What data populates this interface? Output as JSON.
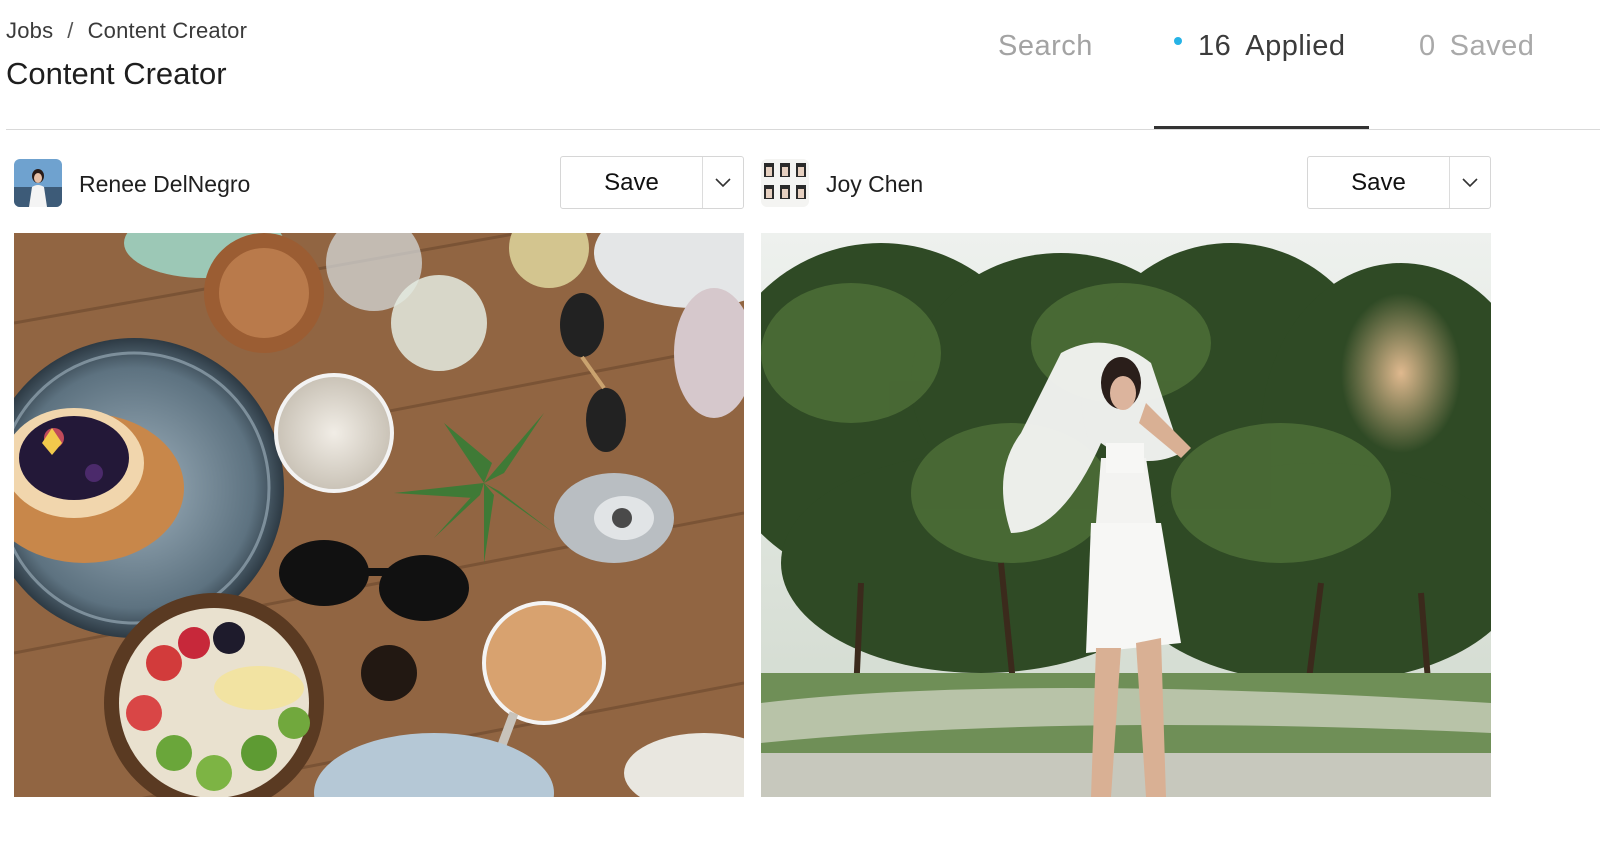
{
  "breadcrumb": {
    "root": "Jobs",
    "separator": "/",
    "current": "Content Creator"
  },
  "page_title": "Content Creator",
  "tabs": {
    "search": {
      "label": "Search"
    },
    "applied": {
      "count": "16",
      "label": "Applied",
      "active": true,
      "indicator_color": "#26b3e6"
    },
    "saved": {
      "count": "0",
      "label": "Saved"
    }
  },
  "candidates": [
    {
      "name": "Renee DelNegro",
      "save_label": "Save",
      "dropdown_icon": "chevron-down-icon",
      "photo_subject": "food-table-flatlay"
    },
    {
      "name": "Joy Chen",
      "save_label": "Save",
      "dropdown_icon": "chevron-down-icon",
      "photo_subject": "woman-veil-park"
    }
  ]
}
